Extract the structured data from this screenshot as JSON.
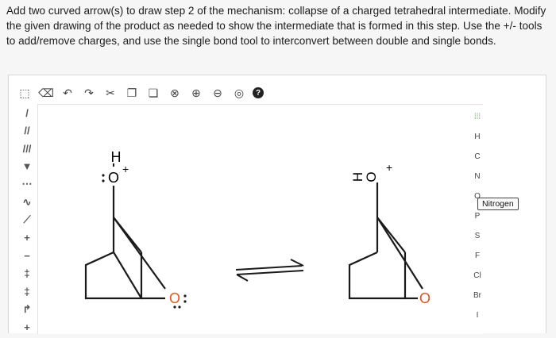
{
  "question": {
    "text": "Add two curved arrow(s) to draw step 2 of the mechanism: collapse of a charged tetrahedral intermediate. Modify the given drawing of the product as needed to show the intermediate that is formed in this step. Use the +/- tools to add/remove charges, and use the single bond tool to interconvert between double and single bonds."
  },
  "toolbar": {
    "items": [
      {
        "name": "select-icon",
        "glyph": "⬚"
      },
      {
        "name": "eraser-icon",
        "glyph": "⌫"
      },
      {
        "name": "undo-icon",
        "glyph": "↶"
      },
      {
        "name": "redo-icon",
        "glyph": "↷"
      },
      {
        "name": "cut-icon",
        "glyph": "✂"
      },
      {
        "name": "copy-icon",
        "glyph": "❐"
      },
      {
        "name": "paste-icon",
        "glyph": "❏"
      },
      {
        "name": "clean-icon",
        "glyph": "⊗"
      },
      {
        "name": "zoom-in-icon",
        "glyph": "⊕"
      },
      {
        "name": "zoom-out-icon",
        "glyph": "⊖"
      },
      {
        "name": "zoom-fit-icon",
        "glyph": "◎"
      },
      {
        "name": "help-icon",
        "glyph": "?"
      }
    ]
  },
  "left_tools": [
    {
      "name": "single-bond-tool",
      "glyph": "/"
    },
    {
      "name": "double-bond-tool",
      "glyph": "//"
    },
    {
      "name": "triple-bond-tool",
      "glyph": "///"
    },
    {
      "name": "wedge-bond-tool",
      "glyph": "▼"
    },
    {
      "name": "hash-bond-tool",
      "glyph": "⋯"
    },
    {
      "name": "wavy-bond-tool",
      "glyph": "∿"
    },
    {
      "name": "chain-tool",
      "glyph": "⟋"
    },
    {
      "name": "plus-charge-tool",
      "glyph": "+"
    },
    {
      "name": "minus-charge-tool",
      "glyph": "−"
    },
    {
      "name": "lone-pair-tool",
      "glyph": "‡"
    },
    {
      "name": "radical-tool",
      "glyph": "‡"
    },
    {
      "name": "curved-arrow-tool",
      "glyph": "↱"
    },
    {
      "name": "more-tool",
      "glyph": "+"
    }
  ],
  "elements": {
    "periodic": "⁞⁞⁞",
    "list": [
      "H",
      "C",
      "N",
      "O",
      "P",
      "S",
      "F",
      "Cl",
      "Br",
      "I"
    ]
  },
  "tooltip": {
    "text": "Nitrogen"
  },
  "molecule_left": {
    "h_label": "H",
    "o_label": "O",
    "charge": "+",
    "o2_label": "O"
  },
  "molecule_right": {
    "h_label": "H",
    "o_label": "O",
    "charge": "+",
    "o2_label": "O"
  },
  "colors": {
    "ring_oxygen": "#e8541b",
    "bond": "#1a1a1a"
  }
}
